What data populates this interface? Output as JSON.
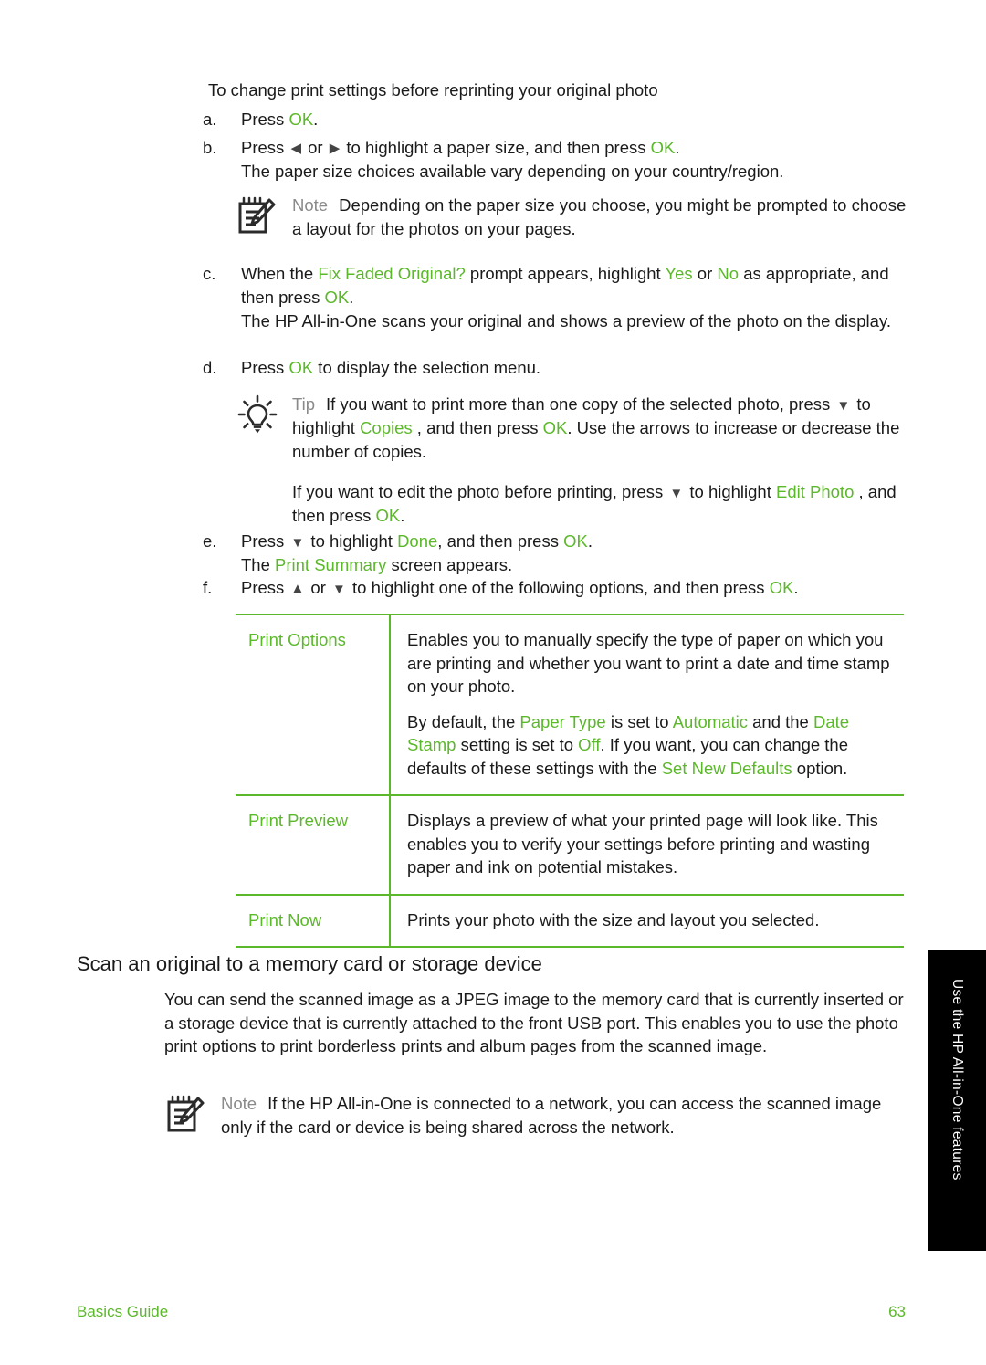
{
  "colors": {
    "accent_green": "#5cb82b",
    "body_text": "#1a1a1a",
    "label_gray": "#8a8a8a",
    "tab_background": "#000000"
  },
  "intro": {
    "text": "To change print settings before reprinting your original photo"
  },
  "steps": {
    "a": {
      "marker": "a.",
      "pre": "Press ",
      "key": "OK",
      "post": "."
    },
    "b": {
      "marker": "b.",
      "pre": "Press ",
      "left_arrow": "◀",
      "mid": " or ",
      "right_arrow": "▶",
      "mid2": " to highlight a paper size, and then press ",
      "key": "OK",
      "post": ".",
      "sub": "The paper size choices available vary depending on your country/region."
    },
    "c": {
      "marker": "c.",
      "pre": "When the ",
      "prompt": "Fix Faded Original?",
      "mid": "  prompt appears, highlight ",
      "yes": "Yes",
      "or": " or ",
      "no": "No",
      "post": " as appropriate, and then press ",
      "key": "OK",
      "end": ".",
      "sub": "The HP All-in-One scans your original and shows a preview of the photo on the display."
    },
    "d": {
      "marker": "d.",
      "pre": "Press ",
      "key": "OK",
      "post": " to display the selection menu."
    },
    "e": {
      "marker": "e.",
      "pre": "Press ",
      "down_arrow": "▼",
      "mid": " to highlight ",
      "done": "Done",
      "post": ", and then press ",
      "key": "OK",
      "end": ".",
      "sub_pre": "The ",
      "sub_term": "Print Summary",
      "sub_post": "  screen appears."
    },
    "f": {
      "marker": "f.",
      "pre": "Press ",
      "up_arrow": "▲",
      "mid": " or ",
      "down_arrow": "▼",
      "mid2": " to highlight one of the following options, and then press ",
      "key": "OK",
      "end": "."
    }
  },
  "note_paper_size": {
    "icon": "note-pad-pencil-icon",
    "label": "Note",
    "text": "Depending on the paper size you choose, you might be prompted to choose a layout for the photos on your pages."
  },
  "tip_copies": {
    "icon": "lightbulb-icon",
    "label": "Tip",
    "p1_pre": "If you want to print more than one copy of the selected photo, press ",
    "p1_arrow": "▼",
    "p1_mid": " to highlight ",
    "p1_term": "Copies",
    "p1_mid2": " , and then press ",
    "p1_key": "OK",
    "p1_post": ". Use the arrows to increase or decrease the number of copies.",
    "p2_pre": "If you want to edit the photo before printing, press ",
    "p2_arrow": "▼",
    "p2_mid": " to highlight ",
    "p2_term": "Edit Photo",
    "p2_mid2": " , and then press ",
    "p2_key": "OK",
    "p2_post": "."
  },
  "options_table": {
    "rows": [
      {
        "name": "Print Options",
        "paragraphs": [
          {
            "segments": [
              {
                "t": "Enables you to manually specify the type of paper on which you are printing and whether you want to print a date and time stamp on your photo.",
                "c": "plain"
              }
            ]
          },
          {
            "segments": [
              {
                "t": "By default, the ",
                "c": "plain"
              },
              {
                "t": "Paper Type",
                "c": "green"
              },
              {
                "t": " is set to ",
                "c": "plain"
              },
              {
                "t": "Automatic",
                "c": "green"
              },
              {
                "t": " and the ",
                "c": "plain"
              },
              {
                "t": "Date Stamp",
                "c": "green"
              },
              {
                "t": " setting is set to ",
                "c": "plain"
              },
              {
                "t": "Off",
                "c": "green"
              },
              {
                "t": ". If you want, you can change the defaults of these settings with the ",
                "c": "plain"
              },
              {
                "t": "Set New Defaults",
                "c": "green"
              },
              {
                "t": " option.",
                "c": "plain"
              }
            ]
          }
        ]
      },
      {
        "name": "Print Preview",
        "paragraphs": [
          {
            "segments": [
              {
                "t": "Displays a preview of what your printed page will look like. This enables you to verify your settings before printing and wasting paper and ink on potential mistakes.",
                "c": "plain"
              }
            ]
          }
        ]
      },
      {
        "name": "Print Now",
        "paragraphs": [
          {
            "segments": [
              {
                "t": "Prints your photo with the size and layout you selected.",
                "c": "plain"
              }
            ]
          }
        ]
      }
    ]
  },
  "section": {
    "heading": "Scan an original to a memory card or storage device",
    "paragraph": "You can send the scanned image as a JPEG image to the memory card that is currently inserted or a storage device that is currently attached to the front USB port. This enables you to use the photo print options to print borderless prints and album pages from the scanned image."
  },
  "note_network": {
    "icon": "note-pad-pencil-icon",
    "label": "Note",
    "text": "If the HP All-in-One is connected to a network, you can access the scanned image only if the card or device is being shared across the network."
  },
  "side_tab": {
    "label": "Use the HP All-in-One features"
  },
  "footer": {
    "guide": "Basics Guide",
    "page_number": "63"
  }
}
